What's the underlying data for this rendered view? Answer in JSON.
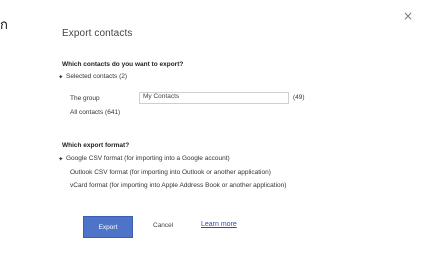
{
  "edge_glyph": "ก",
  "dialog": {
    "title": "Export contacts",
    "close_label": "×",
    "section1": {
      "question": "Which contacts do you want to export?",
      "options": [
        {
          "label": "Selected contacts (2)",
          "selected": true
        },
        {
          "label": "The group",
          "selected": false
        },
        {
          "label": "All contacts (641)",
          "selected": false
        }
      ],
      "group_select_value": "My Contacts",
      "group_count": "(49)"
    },
    "section2": {
      "question": "Which export format?",
      "options": [
        {
          "label": "Google CSV format (for importing into a Google account)",
          "selected": true
        },
        {
          "label": "Outlook CSV format (for importing into Outlook or another application)",
          "selected": false
        },
        {
          "label": "vCard format (for importing into Apple Address Book or another application)",
          "selected": false
        }
      ]
    },
    "buttons": {
      "export_label": "Export",
      "cancel_label": "Cancel",
      "learn_more_label": "Learn more"
    }
  }
}
